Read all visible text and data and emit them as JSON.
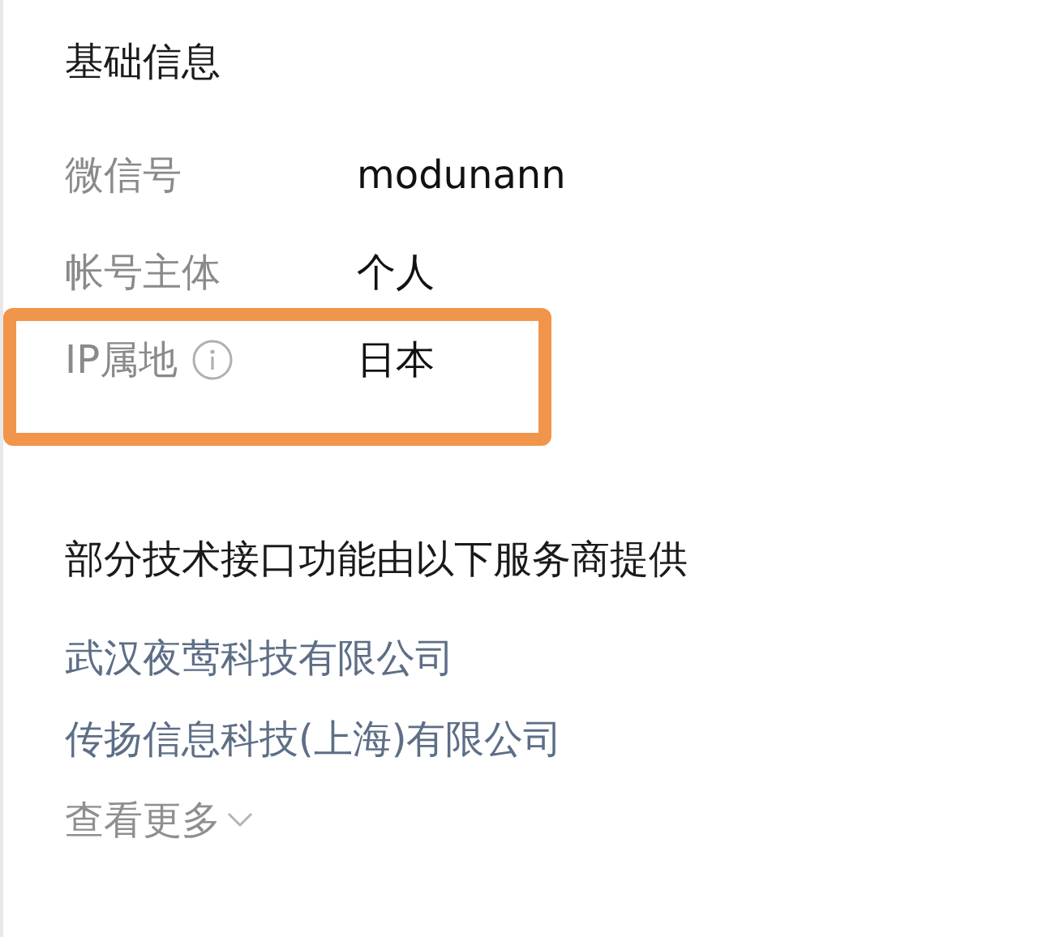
{
  "basic_info": {
    "title": "基础信息",
    "rows": [
      {
        "label": "微信号",
        "value": "modunann",
        "info_icon": false,
        "highlighted": false
      },
      {
        "label": "帐号主体",
        "value": "个人",
        "info_icon": false,
        "highlighted": false
      },
      {
        "label": "IP属地",
        "value": "日本",
        "info_icon": true,
        "highlighted": true
      }
    ]
  },
  "providers": {
    "title": "部分技术接口功能由以下服务商提供",
    "links": [
      "武汉夜莺科技有限公司",
      "传扬信息科技(上海)有限公司"
    ],
    "more": "查看更多"
  }
}
